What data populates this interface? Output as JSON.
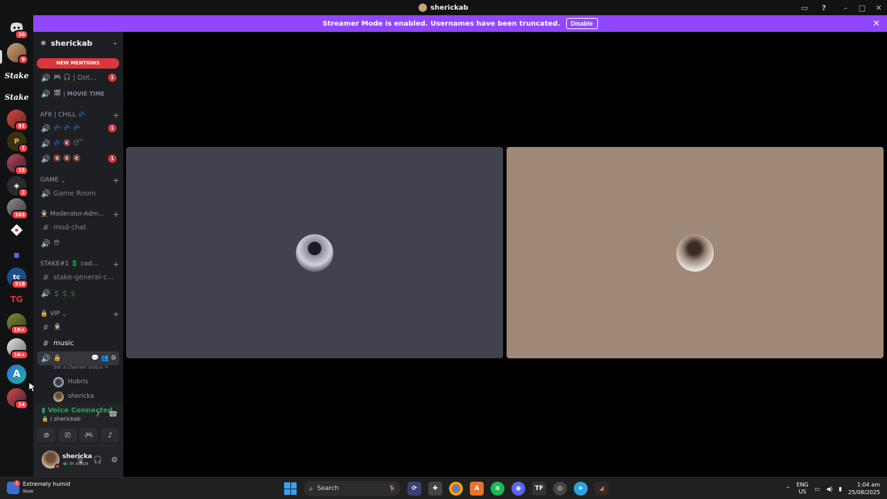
{
  "window": {
    "title": "sherickab",
    "icons": [
      "inbox-icon",
      "help-icon"
    ],
    "controls": [
      "minimize",
      "maximize",
      "close"
    ]
  },
  "banner": {
    "text": "Streamer Mode is enabled. Usernames have been truncated.",
    "button": "Disable"
  },
  "rail": {
    "badges": [
      "30",
      "9",
      "91",
      "1",
      "25",
      "2",
      "163",
      "518",
      "1K+",
      "1K+",
      "24"
    ]
  },
  "server": {
    "name": "sherickab",
    "new_mentions": "NEW MENTIONS"
  },
  "channels": {
    "dot": "| Dot...",
    "dot_badge": "1",
    "movie": "| MOVIE TIME",
    "afk_cat": "AFK | CHILL 💤",
    "afk_1_badge": "1",
    "afk_3_badge": "1",
    "game_cat": "GAME",
    "game_room": "Game Room",
    "mod_cat": "Moderator-Adm...",
    "mod_chat": "mod-chat",
    "stake_cat": "STAKE#1 💲 cod...",
    "stake_general": "stake-general-c...",
    "vip_cat": "VIP",
    "music": "music",
    "set_status": "Set a channel status"
  },
  "voice_users": [
    "Hubris",
    "shericka"
  ],
  "voice_panel": {
    "title": "Voice Connected",
    "sub": "/ sherickab"
  },
  "user": {
    "name": "shericka",
    "status": "In voice"
  },
  "taskbar": {
    "weather_title": "Extremely humid",
    "weather_sub": "Now",
    "weather_badge": "1",
    "search": "Search",
    "lang1": "ENG",
    "lang2": "US",
    "time": "1:04 am",
    "date": "25/08/2025"
  },
  "colors": {
    "banner": "#9147ff",
    "tile_left": "#42424e",
    "tile_right": "#a08876",
    "voice_green": "#23a55a",
    "badge_red": "#f23f43"
  }
}
